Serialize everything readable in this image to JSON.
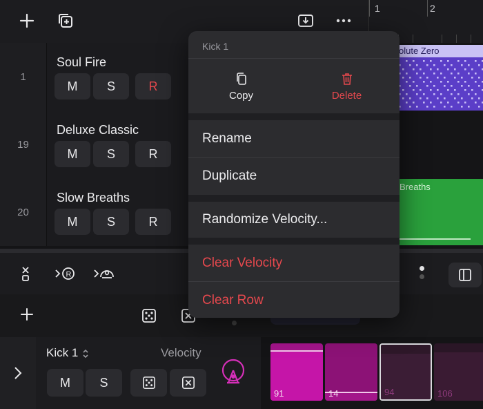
{
  "ruler": {
    "marks": [
      "1",
      "2"
    ]
  },
  "tracks": [
    {
      "number": "1",
      "name": "Soul Fire",
      "m": "M",
      "s": "S",
      "r": "R"
    },
    {
      "number": "19",
      "name": "Deluxe Classic",
      "m": "M",
      "s": "S",
      "r": "R"
    },
    {
      "number": "20",
      "name": "Slow Breaths",
      "m": "M",
      "s": "S",
      "r": "R"
    }
  ],
  "regions": {
    "region1_label": "olute Zero",
    "region2_label": "Breaths",
    "pattern_label": "Absolute Zero"
  },
  "context_menu": {
    "title": "Kick 1",
    "copy_label": "Copy",
    "delete_label": "Delete",
    "rename_label": "Rename",
    "duplicate_label": "Duplicate",
    "randomize_label": "Randomize Velocity...",
    "clear_velocity_label": "Clear Velocity",
    "clear_row_label": "Clear Row"
  },
  "editor": {
    "row_name": "Kick 1",
    "velocity_label": "Velocity",
    "m": "M",
    "s": "S"
  },
  "steps": [
    {
      "value": "91",
      "level": 0.86
    },
    {
      "value": "14",
      "level": 0.13
    },
    {
      "value": "94",
      "level": 0.79
    },
    {
      "value": "106",
      "level": 0.84
    }
  ],
  "colors": {
    "accent_red": "#e5484d",
    "region_purple": "#5b3ec8",
    "region_green": "#2aa13c",
    "step_magenta": "#c515a8"
  }
}
